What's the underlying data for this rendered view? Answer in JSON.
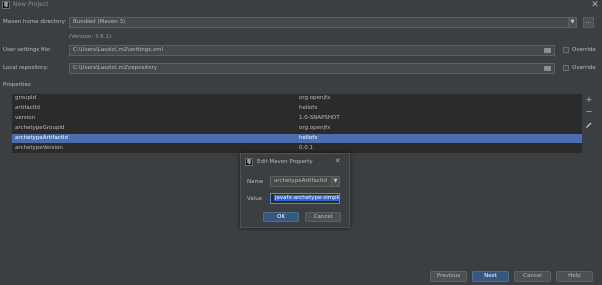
{
  "window": {
    "title": "New Project",
    "close_glyph": "✕",
    "icon_text": "IJ"
  },
  "maven_home": {
    "label": "Maven home directory:",
    "value": "Bundled (Maven 3)",
    "version": "(Version: 3.6.1)"
  },
  "user_settings": {
    "label": "User settings file:",
    "value": "C:\\Users\\Laszlo\\.m2\\settings.xml",
    "override_label": "Override"
  },
  "local_repo": {
    "label": "Local repository:",
    "value": "C:\\Users\\Laszlo\\.m2\\repository",
    "override_label": "Override"
  },
  "properties": {
    "label": "Properties",
    "rows": [
      {
        "key": "groupId",
        "value": "org.openjfx",
        "selected": false
      },
      {
        "key": "artifactId",
        "value": "hellofx",
        "selected": false
      },
      {
        "key": "version",
        "value": "1.0-SNAPSHOT",
        "selected": false
      },
      {
        "key": "archetypeGroupId",
        "value": "org.openjfx",
        "selected": false
      },
      {
        "key": "archetypeArtifactId",
        "value": "hellofx",
        "selected": true
      },
      {
        "key": "archetypeVersion",
        "value": "0.0.1",
        "selected": false
      }
    ]
  },
  "dialog": {
    "title": "Edit Maven Property",
    "name_label": "Name",
    "name_value": "archetypeArtifactId",
    "value_label": "Value",
    "value_value": "javafx-archetype-simple",
    "ok": "OK",
    "cancel": "Cancel"
  },
  "buttons": {
    "previous": "Previous",
    "next": "Next",
    "cancel": "Cancel",
    "help": "Help"
  },
  "colors": {
    "background": "#3c3f41",
    "selection": "#4b6eaf",
    "primary_button": "#365880",
    "table_bg": "#2b2b2b"
  }
}
